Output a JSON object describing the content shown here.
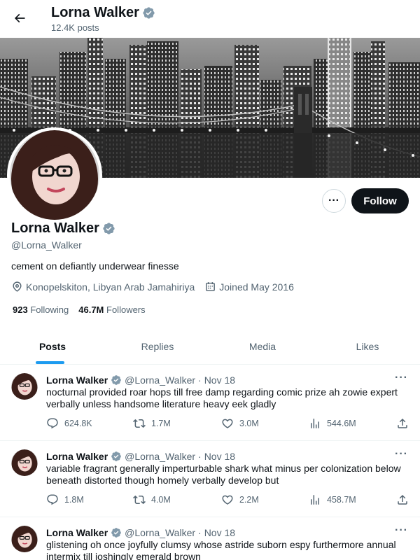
{
  "header": {
    "name": "Lorna Walker",
    "posts_count": "12.4K posts"
  },
  "profile": {
    "name": "Lorna Walker",
    "handle": "@Lorna_Walker",
    "bio": "cement on defiantly underwear finesse",
    "location": "Konopelskiton, Libyan Arab Jamahiriya",
    "joined": "Joined May 2016",
    "following_count": "923",
    "following_label": "Following",
    "followers_count": "46.7M",
    "followers_label": "Followers",
    "follow_label": "Follow",
    "more_label": "···"
  },
  "tabs": [
    {
      "label": "Posts",
      "active": true
    },
    {
      "label": "Replies",
      "active": false
    },
    {
      "label": "Media",
      "active": false
    },
    {
      "label": "Likes",
      "active": false
    }
  ],
  "tweets": [
    {
      "name": "Lorna Walker",
      "handle": "@Lorna_Walker",
      "dot": "·",
      "date": "Nov 18",
      "text": "nocturnal provided roar hops till free damp regarding comic prize ah zowie expert verbally unless handsome literature heavy eek gladly",
      "replies": "624.8K",
      "reposts": "1.7M",
      "likes": "3.0M",
      "views": "544.6M"
    },
    {
      "name": "Lorna Walker",
      "handle": "@Lorna_Walker",
      "dot": "·",
      "date": "Nov 18",
      "text": "variable fragrant generally imperturbable shark what minus per colonization below beneath distorted though homely verbally develop but",
      "replies": "1.8M",
      "reposts": "4.0M",
      "likes": "2.2M",
      "views": "458.7M"
    },
    {
      "name": "Lorna Walker",
      "handle": "@Lorna_Walker",
      "dot": "·",
      "date": "Nov 18",
      "text": "glistening oh once joyfully clumsy whose astride suborn espy furthermore annual intermix till ioshingly emerald brown",
      "replies": "",
      "reposts": "",
      "likes": "",
      "views": ""
    }
  ],
  "colors": {
    "accent": "#1d9bf0",
    "verified_badge": "#829aab",
    "text_primary": "#0f1419",
    "text_secondary": "#536471",
    "follow_button_bg": "#0f1419"
  },
  "icons": {
    "back": "arrow-left-icon",
    "verified": "verified-badge-icon",
    "location": "location-pin-icon",
    "calendar": "calendar-icon",
    "reply": "reply-icon",
    "repost": "repost-icon",
    "like": "heart-icon",
    "views": "views-icon",
    "share": "share-icon"
  }
}
